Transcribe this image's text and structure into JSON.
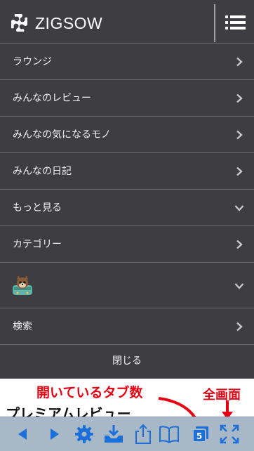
{
  "header": {
    "brand": "ZIGSOW",
    "logo_icon": "puzzle-logo-icon",
    "menu_icon": "hamburger-icon"
  },
  "menu": {
    "items": [
      {
        "label": "ラウンジ",
        "icon": "chevron-right-icon"
      },
      {
        "label": "みんなのレビュー",
        "icon": "chevron-right-icon"
      },
      {
        "label": "みんなの気になるモノ",
        "icon": "chevron-right-icon"
      },
      {
        "label": "みんなの日記",
        "icon": "chevron-right-icon"
      },
      {
        "label": "もっと見る",
        "icon": "chevron-down-icon"
      },
      {
        "label": "カテゴリー",
        "icon": "chevron-right-icon"
      },
      {
        "label": "",
        "icon": "chevron-down-icon",
        "avatar": "mascot-avatar"
      },
      {
        "label": "検索",
        "icon": "chevron-right-icon"
      }
    ],
    "close_label": "閉じる"
  },
  "page": {
    "heading": "プレミアムレビュー"
  },
  "annotations": {
    "tabs_note": "開いているタブ数",
    "fullscreen_note": "全画面",
    "accent_color": "#e60012"
  },
  "toolbar": {
    "tab_count": "5",
    "buttons": [
      "back-arrow-icon",
      "forward-arrow-icon",
      "settings-gear-icon",
      "save-inbox-icon",
      "share-icon",
      "bookmarks-book-icon",
      "tabs-icon",
      "fullscreen-icon"
    ],
    "icon_color": "#1a6fd8"
  },
  "colors": {
    "menu_background": "#3d3d42",
    "divider": "#6b6b70",
    "toolbar_background": "#a9b8c6"
  }
}
